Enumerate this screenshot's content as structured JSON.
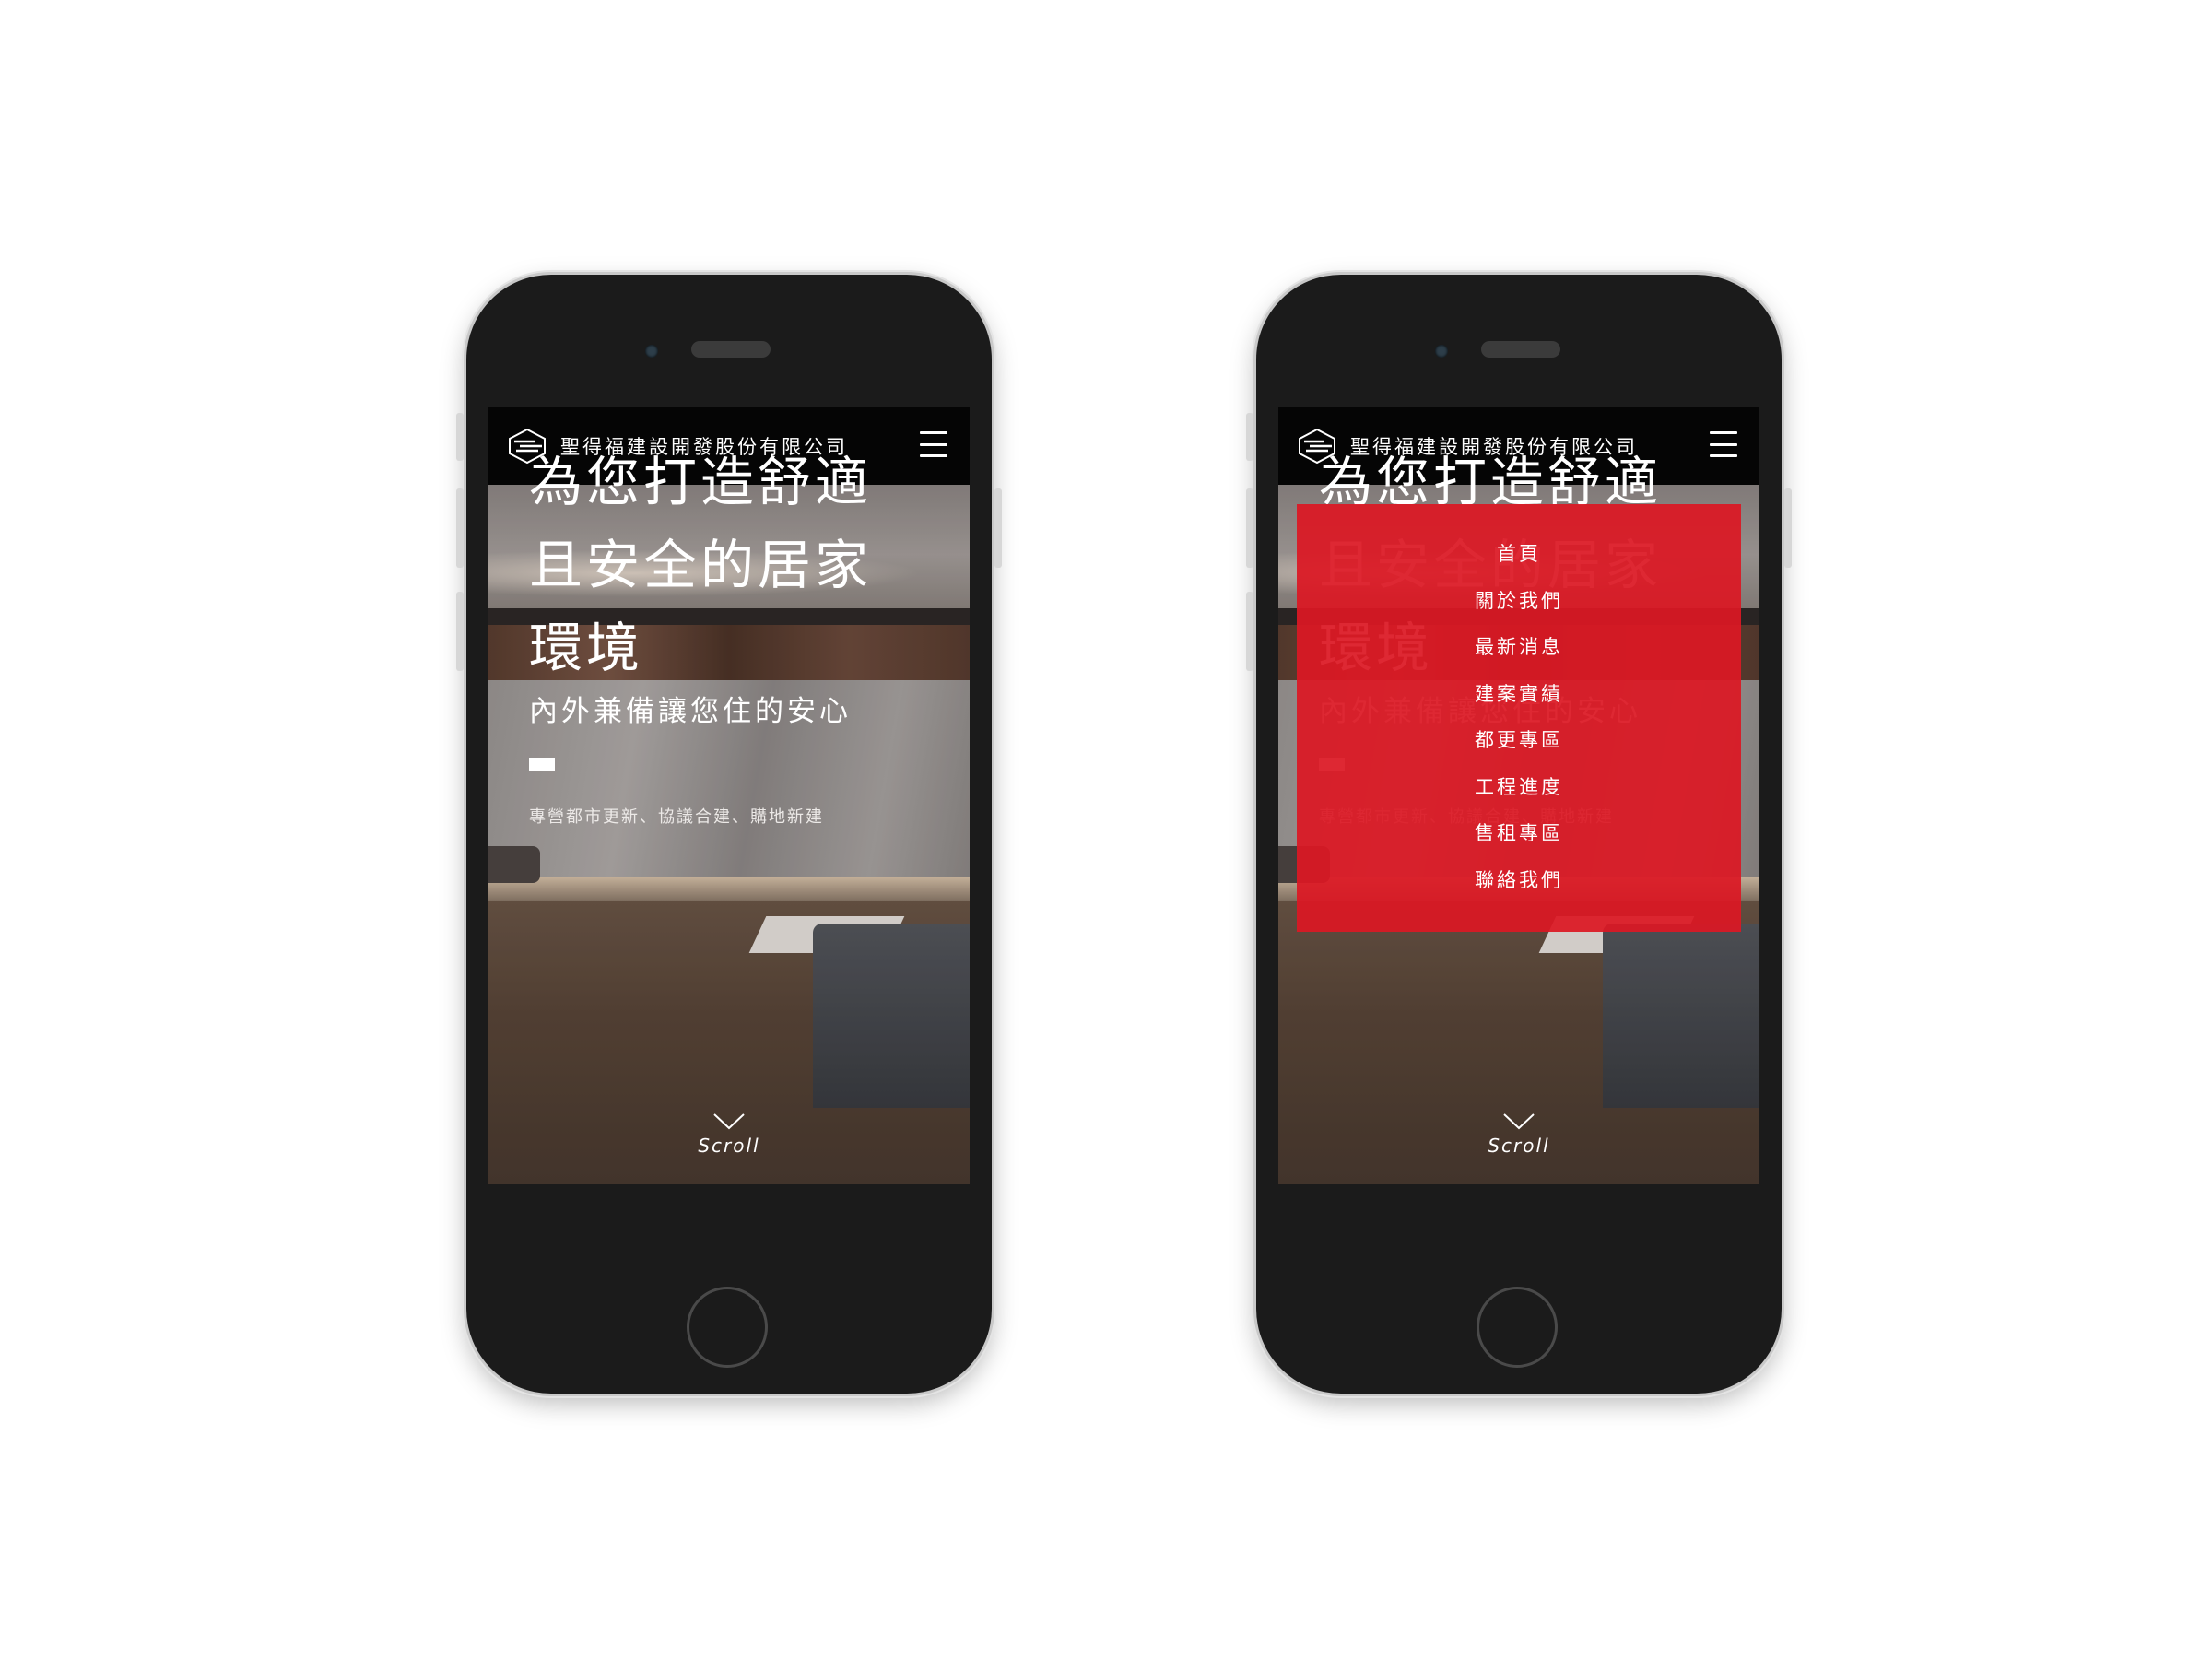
{
  "app": {
    "company_name": "聖得福建設開發股份有限公司"
  },
  "hero": {
    "title_lines": [
      "為您打造舒適",
      "且安全的居家",
      "環境"
    ],
    "subtitle": "內外兼備讓您住的安心",
    "tagline": "專營都市更新、協議合建、購地新建",
    "scroll_label": "Scroll"
  },
  "nav_menu": {
    "items": [
      {
        "label": "首頁"
      },
      {
        "label": "關於我們"
      },
      {
        "label": "最新消息"
      },
      {
        "label": "建案實績"
      },
      {
        "label": "都更專區"
      },
      {
        "label": "工程進度"
      },
      {
        "label": "售租專區"
      },
      {
        "label": "聯絡我們"
      }
    ]
  },
  "icons": {
    "logo": "hexagon-lines-logo-icon",
    "menu": "hamburger-menu-icon",
    "scroll": "chevron-down-icon"
  },
  "colors": {
    "header_bg": "#050505",
    "menu_overlay": "#dc1824",
    "text": "#ffffff"
  }
}
